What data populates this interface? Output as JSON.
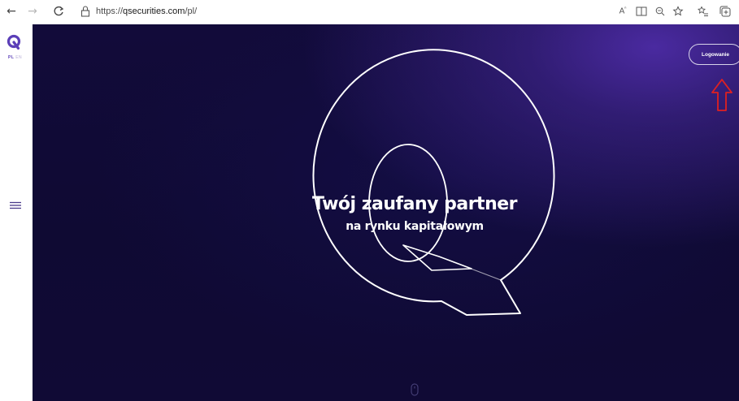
{
  "browser": {
    "url_scheme": "https://",
    "url_host": "qsecurities.com",
    "url_path": "/pl/",
    "toolbar_icons": [
      "read-aloud-icon",
      "immersive-reader-icon",
      "zoom-icon",
      "favorite-star-icon",
      "favorites-list-icon",
      "collections-icon"
    ]
  },
  "sidebar": {
    "lang_active": "PL",
    "lang_inactive": "EN"
  },
  "header": {
    "login_label": "Logowanie"
  },
  "hero": {
    "headline": "Twój zaufany partner",
    "subline": "na rynku kapitałowym"
  },
  "colors": {
    "accent": "#5b3fb8",
    "hero_bg": "#120b3a",
    "annotation_arrow": "#e02020"
  }
}
